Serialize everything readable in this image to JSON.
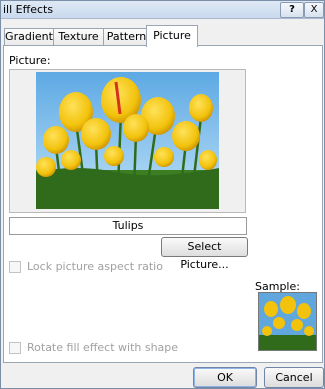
{
  "window": {
    "title": "ill Effects",
    "help_label": "?",
    "close_label": "X"
  },
  "tabs": [
    {
      "label": "Gradient"
    },
    {
      "label": "Texture"
    },
    {
      "label": "Pattern"
    },
    {
      "label": "Picture",
      "selected": true
    }
  ],
  "picture_panel": {
    "picture_label": "Picture:",
    "picture_name": "Tulips",
    "select_button": "Select Picture...",
    "lock_aspect_label": "Lock picture aspect ratio",
    "lock_aspect_checked": false,
    "rotate_label": "Rotate fill effect with shape",
    "rotate_checked": false,
    "sample_label": "Sample:"
  },
  "footer": {
    "ok_label": "OK",
    "cancel_label": "Cancel"
  },
  "colors": {
    "accent": "#8fb5e6",
    "sky": "#8fc6ee",
    "tulip": "#f2c20c",
    "stem": "#2f6b1b"
  }
}
